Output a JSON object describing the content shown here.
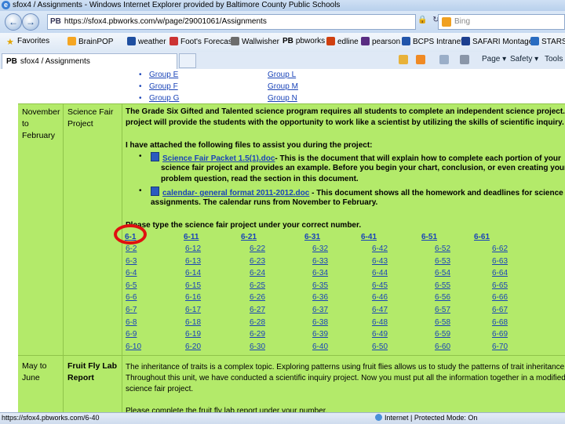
{
  "window": {
    "title": "sfox4 / Assignments - Windows Internet Explorer provided by Baltimore County Public Schools"
  },
  "address": {
    "url": "https://sfox4.pbworks.com/w/page/29001061/Assignments",
    "site_badge": "PB",
    "search_placeholder": "Bing"
  },
  "favorites": {
    "favorites_label": "Favorites",
    "items": [
      {
        "label": "BrainPOP",
        "icon": "brainpop-icon",
        "color": "#f5a623"
      },
      {
        "label": "weather",
        "icon": "weather-icon",
        "color": "#1f4fa0"
      },
      {
        "label": "Foot's Forecast",
        "icon": "forecast-icon",
        "color": "#cc3333"
      },
      {
        "label": "Wallwisher",
        "icon": "wallwisher-icon",
        "color": "#6c6c6c"
      },
      {
        "label": "pbworks",
        "icon": "pbworks-icon",
        "color": "#333333"
      },
      {
        "label": "edline",
        "icon": "edline-icon",
        "color": "#d04010"
      },
      {
        "label": "pearson",
        "icon": "pearson-icon",
        "color": "#5a2d82"
      },
      {
        "label": "BCPS Intranet",
        "icon": "bcps-icon",
        "color": "#2255aa"
      },
      {
        "label": "SAFARI Montage",
        "icon": "safari-icon",
        "color": "#1d3f8f"
      },
      {
        "label": "STARS L",
        "icon": "stars-icon",
        "color": "#2a6cc0"
      }
    ],
    "fav_badge": "PB"
  },
  "tab": {
    "badge": "PB",
    "label": "sfox4 / Assignments"
  },
  "commandbar": {
    "page_label": "Page",
    "safety_label": "Safety",
    "tools_label": "Tools"
  },
  "groups": {
    "left": [
      "Group E",
      "Group F",
      "Group G"
    ],
    "right": [
      "Group L",
      "Group M",
      "Group N"
    ]
  },
  "row1": {
    "date": [
      "November",
      "to",
      "February"
    ],
    "title": [
      "Science Fair",
      "Project"
    ],
    "para1": [
      "The Grade Six Gifted and Talented science program requires all students to complete an independent science project. Thi",
      "project will provide the students with the opportunity to work like a scientist by utilizing the skills of scientific inquiry."
    ],
    "para2": "I have attached the following files to assist you during the project:",
    "file1_link": "Science Fair Packet 1.5(1).doc",
    "file1_desc": [
      "- This is the document that will explain how to complete each portion of your",
      "science fair project and provides an example.  Before you begin your chart, conclusion, or even creating your",
      "problem question, read the section in this document."
    ],
    "file2_link": "calendar- general format 2011-2012.doc",
    "file2_desc": [
      " - This document shows all the homework and deadlines for science fa",
      "assignments.  The calendar runs from November to February."
    ],
    "instruction": "Please type the science fair project under your correct number.",
    "number_columns": [
      [
        "6-1",
        "6-2",
        "6-3",
        "6-4",
        "6-5",
        "6-6",
        "6-7",
        "6-8",
        "6-9",
        "6-10"
      ],
      [
        "6-11",
        "6-12",
        "6-13",
        "6-14",
        "6-15",
        "6-16",
        "6-17",
        "6-18",
        "6-19",
        "6-20"
      ],
      [
        "6-21",
        "6-22",
        "6-23",
        "6-24",
        "6-25",
        "6-26",
        "6-27",
        "6-28",
        "6-29",
        "6-30"
      ],
      [
        "6-31",
        "6-32",
        "6-33",
        "6-34",
        "6-35",
        "6-36",
        "6-37",
        "6-38",
        "6-39",
        "6-40"
      ],
      [
        "6-41",
        "6-42",
        "6-43",
        "6-44",
        "6-45",
        "6-46",
        "6-47",
        "6-48",
        "6-49",
        "6-50"
      ],
      [
        "6-51",
        "6-52",
        "6-53",
        "6-54",
        "6-55",
        "6-56",
        "6-57",
        "6-58",
        "6-59",
        "6-60"
      ],
      [
        "6-61",
        "6-62",
        "6-63",
        "6-64",
        "6-65",
        "6-66",
        "6-67",
        "6-68",
        "6-69",
        "6-70"
      ]
    ],
    "highlight_color": "#e01010"
  },
  "row2": {
    "date": [
      "May to",
      "June"
    ],
    "title": [
      "Fruit Fly Lab",
      "Report"
    ],
    "para": [
      "The inheritance of traits is a complex topic.  Exploring patterns using fruit flies allows us to study the patterns of trait inheritance",
      "Throughout this unit, we have conducted a scientific inquiry project.  Now you must put all the information together in a modified",
      "science fair project.",
      "",
      "Please complete the fruit fly lab report under your number."
    ]
  },
  "status": {
    "url": "https://sfox4.pbworks.com/6-40",
    "zone": "Internet | Protected Mode: On"
  },
  "colors": {
    "page_green": "#b3ea6a",
    "link_blue": "#1a44b8"
  }
}
